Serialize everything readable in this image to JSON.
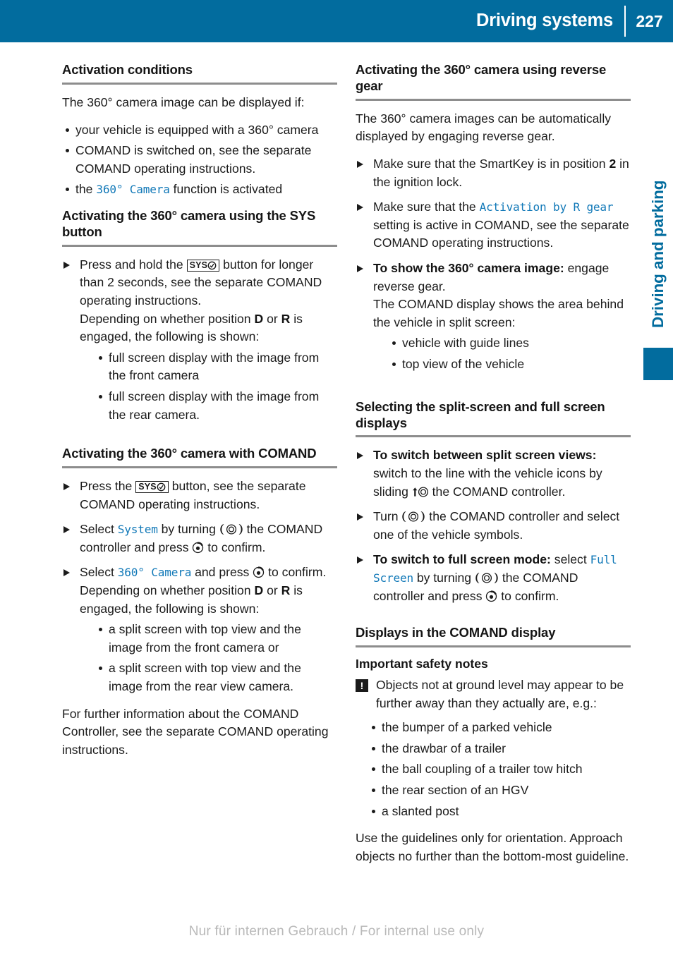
{
  "header": {
    "title": "Driving systems",
    "page_number": "227",
    "accent_color": "#026C9E"
  },
  "side_tab": {
    "label": "Driving and parking"
  },
  "footer": {
    "watermark": "Nur für internen Gebrauch / For internal use only"
  },
  "icons": {
    "sys_button": "sys-button-icon",
    "rotate_controller": "rotate-controller-icon",
    "press_controller": "press-controller-icon",
    "slide_controller": "slide-controller-icon",
    "warning": "warning-icon"
  },
  "left_column": {
    "section1": {
      "heading": "Activation conditions",
      "intro": "The 360° camera image can be displayed if:",
      "bullets": [
        "your vehicle is equipped with a 360° camera",
        "COMAND is switched on, see the separate COMAND operating instructions."
      ],
      "bullet3_pre": "the ",
      "bullet3_code": "360° Camera",
      "bullet3_post": " function is activated"
    },
    "section2": {
      "heading": "Activating the 360° camera using the SYS button",
      "step1_pre": "Press and hold the ",
      "step1_icon_label": "SYS",
      "step1_post": " button for longer than 2 seconds, see the separate COMAND operating instructions.",
      "step1_line2_a": "Depending on whether position ",
      "step1_line2_b": "D",
      "step1_line2_c": " or ",
      "step1_line2_d": "R",
      "step1_line2_e": " is engaged, the following is shown:",
      "sub_bullets": [
        "full screen display with the image from the front camera",
        "full screen display with the image from the rear camera."
      ]
    },
    "section3": {
      "heading": "Activating the 360° camera with COMAND",
      "step1_pre": "Press the ",
      "step1_post": " button, see the separate COMAND operating instructions.",
      "step2_a": "Select ",
      "step2_code": "System",
      "step2_b": " by turning ",
      "step2_c": " the COMAND controller and press ",
      "step2_d": " to confirm.",
      "step3_a": "Select ",
      "step3_code": "360° Camera",
      "step3_b": " and press ",
      "step3_c": " to confirm.",
      "step3_line2_a": "Depending on whether position ",
      "step3_line2_b": "D",
      "step3_line2_c": " or ",
      "step3_line2_d": "R",
      "step3_line2_e": " is engaged, the following is shown:",
      "sub_bullets": [
        "a split screen with top view and the image from the front camera or",
        "a split screen with top view and the image from the rear view camera."
      ],
      "closing": "For further information about the COMAND Controller, see the separate COMAND operating instructions."
    }
  },
  "right_column": {
    "section1": {
      "heading": "Activating the 360° camera using reverse gear",
      "intro": "The 360° camera images can be automatically displayed by engaging reverse gear.",
      "step1_a": "Make sure that the SmartKey is in position ",
      "step1_b": "2",
      "step1_c": " in the ignition lock.",
      "step2_a": "Make sure that the ",
      "step2_code": "Activation by R gear",
      "step2_b": " setting is active in COMAND, see the separate COMAND operating instructions.",
      "step3_bold": "To show the 360° camera image:",
      "step3_rest": " engage reverse gear.",
      "step3_line2": "The COMAND display shows the area behind the vehicle in split screen:",
      "sub_bullets": [
        "vehicle with guide lines",
        "top view of the vehicle"
      ]
    },
    "section2": {
      "heading": "Selecting the split-screen and full screen displays",
      "step1_bold": "To switch between split screen views:",
      "step1_a": " switch to the line with the vehicle icons by sliding ",
      "step1_b": " the COMAND controller.",
      "step2_a": "Turn ",
      "step2_b": " the COMAND controller and select one of the vehicle symbols.",
      "step3_bold": "To switch to full screen mode:",
      "step3_a": " select ",
      "step3_code": "Full Screen",
      "step3_b": " by turning ",
      "step3_c": " the COMAND controller and press ",
      "step3_d": " to confirm."
    },
    "section3": {
      "heading": "Displays in the COMAND display",
      "sub_heading": "Important safety notes",
      "note": "Objects not at ground level may appear to be further away than they actually are, e.g.:",
      "bullets": [
        "the bumper of a parked vehicle",
        "the drawbar of a trailer",
        "the ball coupling of a trailer tow hitch",
        "the rear section of an HGV",
        "a slanted post"
      ],
      "closing": "Use the guidelines only for orientation. Approach objects no further than the bottom-most guideline."
    }
  }
}
